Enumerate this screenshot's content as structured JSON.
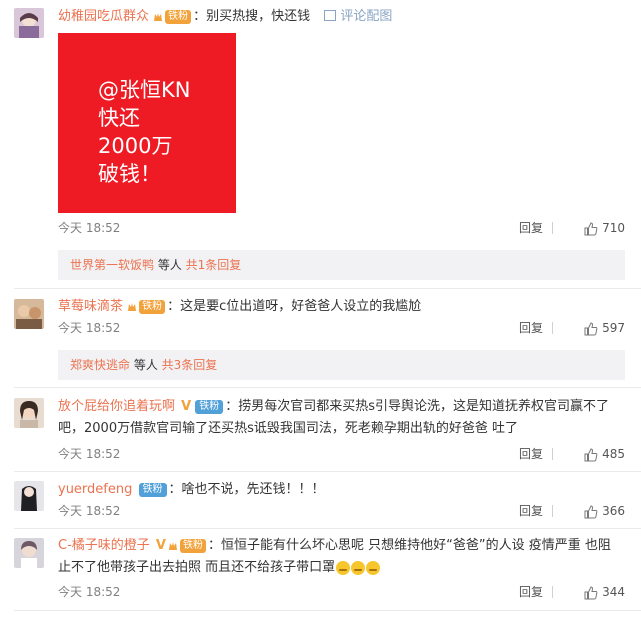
{
  "comments": [
    {
      "username": "幼稚园吃瓜群众",
      "badge": "铁粉",
      "text": "：别买热搜，快还钱",
      "pic_link": "评论配图",
      "image_lines": [
        "@张恒KN",
        "快还",
        "2000万",
        "破钱！"
      ],
      "time": "今天 18:52",
      "reply": "回复",
      "likes": "710",
      "subreply": {
        "who": "世界第一软饭鸭",
        "mid": " 等人 ",
        "count": "共1条回复"
      }
    },
    {
      "username": "草莓味滴茶",
      "badge": "铁粉",
      "text": "：这是要c位出道呀，好爸爸人设立的我尴尬",
      "time": "今天 18:52",
      "reply": "回复",
      "likes": "597",
      "subreply": {
        "who": "郑爽快逃命",
        "mid": " 等人 ",
        "count": "共3条回复"
      }
    },
    {
      "username": "放个屁给你追着玩啊",
      "vip": "V",
      "badge": "铁粉",
      "text_line1": "：捞男每次官司都来买热s引导舆论洗，这是知道抚养权官司赢不了",
      "text_line2": "吧，2000万借款官司输了还买热s诋毁我国司法，死老赖孕期出轨的好爸爸 吐了",
      "time": "今天 18:52",
      "reply": "回复",
      "likes": "485"
    },
    {
      "username": "yuerdefeng",
      "badge": "铁粉",
      "text": "：啥也不说，先还钱！！！",
      "time": "今天 18:52",
      "reply": "回复",
      "likes": "366"
    },
    {
      "username": "C-橘子味的橙子",
      "vip": "V",
      "badge": "铁粉",
      "text_line1": "：恒恒子能有什么坏心思呢 只想维持他好“爸爸”的人设  疫情严重 也阻",
      "text_line2": "止不了他带孩子出去拍照 而且还不给孩子带口罩",
      "time": "今天 18:52",
      "reply": "回复",
      "likes": "344"
    }
  ],
  "colors": {
    "username": "#eb7350",
    "fan_badge": "#f2a23a",
    "blue_badge": "#52a0d8",
    "subreply_bg": "#f2f2f5",
    "image_red": "#ee1b24"
  }
}
